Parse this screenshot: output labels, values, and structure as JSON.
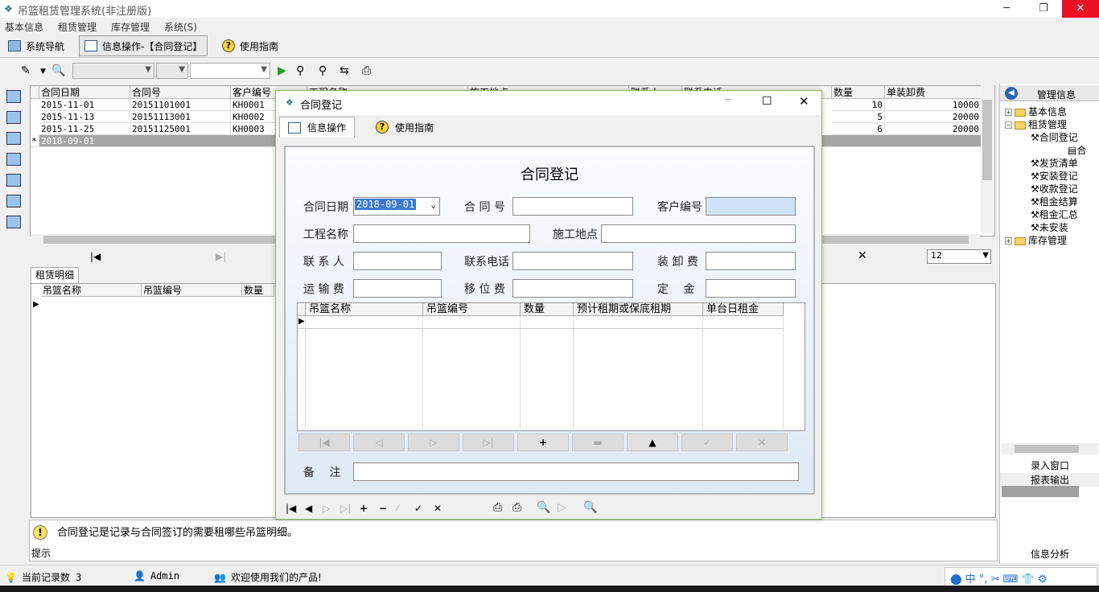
{
  "window": {
    "title": "吊篮租赁管理系统(非注册版)",
    "min": "─",
    "max": "❐",
    "close": "✕"
  },
  "menu": [
    "基本信息",
    "租赁管理",
    "库存管理",
    "系统(S)"
  ],
  "nav": {
    "system_nav": "系统导航",
    "info_op": "信息操作-【合同登记】",
    "guide": "使用指南"
  },
  "grid": {
    "headers": [
      "合同日期",
      "合同号",
      "客户编号",
      "工程名称",
      "施工地点",
      "联系人",
      "联系电话",
      "数量",
      "单装卸费"
    ],
    "rows": [
      {
        "date": "2015-11-01",
        "no": "20151101001",
        "cust": "KH0001",
        "qty": "10",
        "fee": "10000"
      },
      {
        "date": "2015-11-13",
        "no": "20151113001",
        "cust": "KH0002",
        "qty": "5",
        "fee": "20000"
      },
      {
        "date": "2015-11-25",
        "no": "20151125001",
        "cust": "KH0003",
        "qty": "6",
        "fee": "20000"
      }
    ],
    "new_row": {
      "marker": "*",
      "date": "2018-09-01"
    }
  },
  "pager": {
    "page_size": "12"
  },
  "detail": {
    "tab": "租赁明细",
    "headers": [
      "吊篮名称",
      "吊篮编号",
      "数量"
    ]
  },
  "right_panel": {
    "header": "管理信息",
    "tree": {
      "basic": "基本信息",
      "rent": "租赁管理",
      "contract": "合同登记",
      "contract_child": "合",
      "items": [
        "发货清单",
        "安装登记",
        "收款登记",
        "租金结算",
        "租金汇总",
        "未安装"
      ],
      "stock": "库存管理"
    },
    "links": {
      "entry": "录入窗口",
      "report": "报表输出",
      "analysis": "信息分析"
    }
  },
  "tip": {
    "label": "提示",
    "text": "合同登记是记录与合同签订的需要租哪些吊篮明细。"
  },
  "status": {
    "records": "当前记录数 3",
    "user": "Admin",
    "welcome": "欢迎使用我们的产品!"
  },
  "dialog": {
    "title": "合同登记",
    "tab_info": "信息操作",
    "tab_guide": "使用指南",
    "heading": "合同登记",
    "labels": {
      "date": "合同日期",
      "contract_no": "合 同 号",
      "customer_no": "客户编号",
      "project": "工程名称",
      "site": "施工地点",
      "contact": "联 系 人",
      "phone": "联系电话",
      "loading_fee": "装 卸 费",
      "transport": "运 输 费",
      "move_fee": "移 位 费",
      "deposit": "定　 金",
      "remark": "备　 注"
    },
    "values": {
      "date": "2018-09-01"
    },
    "grid_headers": [
      "吊篮名称",
      "吊篮编号",
      "数量",
      "预计租期或保底租期",
      "单台日租金"
    ]
  },
  "colors": {
    "accent_border": "#8fbc62",
    "selected_row": "#a6a6a6",
    "close_red": "#e81123"
  }
}
